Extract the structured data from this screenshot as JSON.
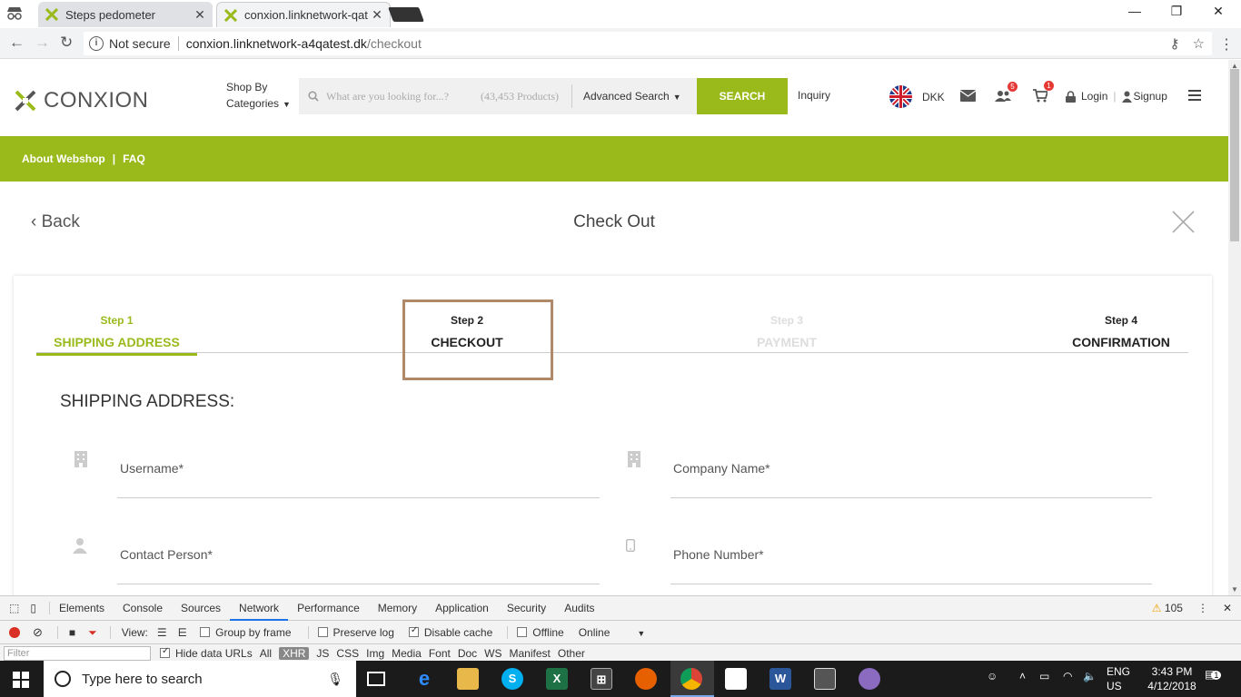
{
  "browser": {
    "tabs": [
      {
        "title": "Steps pedometer"
      },
      {
        "title": "conxion.linknetwork-qat"
      }
    ],
    "url": {
      "security": "Not secure",
      "host": "conxion.linknetwork-a4qatest.dk",
      "path": "/checkout"
    }
  },
  "header": {
    "logo_text": "CONXION",
    "shop_by": [
      "Shop By",
      "Categories"
    ],
    "search": {
      "placeholder": "What are you looking for...?",
      "product_count": "(43,453 Products)",
      "advanced": "Advanced Search",
      "button": "SEARCH"
    },
    "inquiry": "Inquiry",
    "currency": "DKK",
    "badges": {
      "users": "5",
      "cart": "1"
    },
    "login": "Login",
    "signup": "Signup"
  },
  "greennav": {
    "items": [
      "About Webshop",
      "|",
      "FAQ"
    ]
  },
  "checkout": {
    "back": "Back",
    "title": "Check Out",
    "steps": [
      {
        "num": "Step 1",
        "label": "SHIPPING ADDRESS"
      },
      {
        "num": "Step 2",
        "label": "CHECKOUT"
      },
      {
        "num": "Step 3",
        "label": "PAYMENT"
      },
      {
        "num": "Step 4",
        "label": "CONFIRMATION"
      }
    ],
    "section_title": "SHIPPING ADDRESS:",
    "fields": {
      "username": "Username*",
      "company": "Company Name*",
      "contact": "Contact Person*",
      "phone": "Phone Number*"
    }
  },
  "devtools": {
    "tabs": [
      "Elements",
      "Console",
      "Sources",
      "Network",
      "Performance",
      "Memory",
      "Application",
      "Security",
      "Audits"
    ],
    "active_tab": "Network",
    "warnings": "105",
    "view_label": "View:",
    "group_by_frame": "Group by frame",
    "preserve_log": "Preserve log",
    "disable_cache": "Disable cache",
    "offline": "Offline",
    "throttle": "Online",
    "filter_placeholder": "Filter",
    "hide_data_urls": "Hide data URLs",
    "types": [
      "All",
      "XHR",
      "JS",
      "CSS",
      "Img",
      "Media",
      "Font",
      "Doc",
      "WS",
      "Manifest",
      "Other"
    ]
  },
  "taskbar": {
    "search_placeholder": "Type here to search",
    "lang": [
      "ENG",
      "US"
    ],
    "time": "3:43 PM",
    "date": "4/12/2018",
    "notifications": "1"
  },
  "colors": {
    "brand_green": "#9aba1b",
    "highlight_border": "#b08a68",
    "badge_red": "#e53935"
  }
}
